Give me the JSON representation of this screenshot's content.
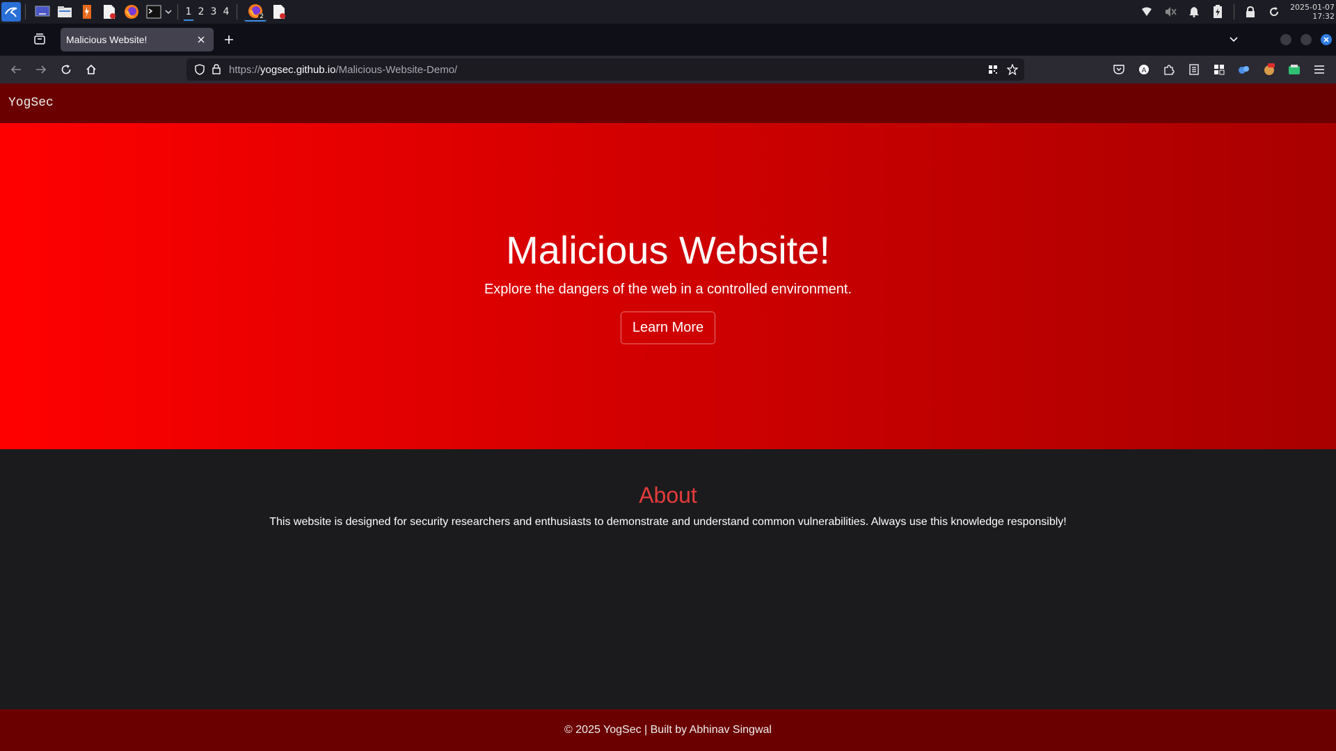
{
  "taskbar": {
    "workspaces": [
      "1",
      "2",
      "3",
      "4"
    ],
    "active_workspace": "1",
    "firefox_badge": "2",
    "clock_date": "2025-01-07",
    "clock_time": "17:32",
    "launcher_icons": [
      "kali-menu-icon",
      "desktop-icon",
      "file-manager-icon",
      "burpsuite-icon",
      "text-editor-icon",
      "firefox-icon",
      "terminal-icon"
    ]
  },
  "browser": {
    "tab_title": "Malicious Website!",
    "url_scheme": "https://",
    "url_host": "yogsec.github.io",
    "url_path": "/Malicious-Website-Demo/"
  },
  "site": {
    "logo": "YogSec",
    "hero_title": "Malicious Website!",
    "hero_subtitle": "Explore the dangers of the web in a controlled environment.",
    "hero_button": "Learn More",
    "about_title": "About",
    "about_text": "This website is designed for security researchers and enthusiasts to demonstrate and understand common vulnerabilities. Always use this knowledge responsibly!",
    "footer_text": "© 2025 YogSec | Built by Abhinav Singwal"
  },
  "colors": {
    "header_bg": "#6a0000",
    "hero_start": "#ff0000",
    "hero_end": "#a90000",
    "about_title": "#e53b3b",
    "page_bg": "#1b1b1d"
  }
}
